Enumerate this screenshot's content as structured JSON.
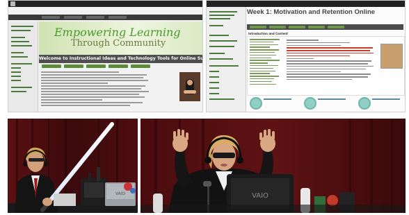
{
  "screenshot_left": {
    "banner_line1": "Empowering Learning",
    "banner_line2": "Through Community",
    "welcome_title": "Welcome to Instructional Ideas and Technology Tools for Online Success"
  },
  "screenshot_right": {
    "page_title": "Week 1: Motivation and Retention Online",
    "section_label": "Introduction and Content"
  },
  "photo_left": {
    "laptop_brand": "VAIO"
  },
  "photo_right": {
    "laptop_brand": "VAIO"
  },
  "colors": {
    "banner_green": "#4a9a2a",
    "course_nav_green": "#6d9a47",
    "backdrop_red": "#3c0b0d"
  }
}
